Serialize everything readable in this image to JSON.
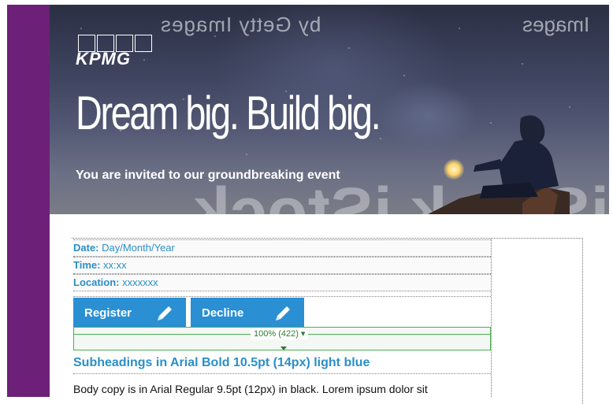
{
  "hero": {
    "watermark_top": "by Getty Images",
    "watermark_top_right": "Images",
    "watermark_bottom": "iStock  iStock",
    "logo": "KPMG",
    "headline": "Dream big. Build big.",
    "invitation": "You are invited to our groundbreaking event"
  },
  "details": {
    "date_label": "Date:",
    "date_value": " Day/Month/Year",
    "time_label": "Time:",
    "time_value": " xx:xx",
    "location_label": "Location:",
    "location_value": " xxxxxxx"
  },
  "buttons": {
    "register": "Register",
    "decline": "Decline"
  },
  "selection": {
    "badge": "100% (422) ▾"
  },
  "subheading": "Subheadings in Arial Bold 10.5pt (14px) light blue",
  "body_copy": "Body copy is in Arial Regular 9.5pt (12px) in black. Lorem ipsum dolor sit",
  "colors": {
    "brand_purple": "#6d2077",
    "link_blue": "#2a8fc8",
    "button_blue": "#2a8fd3",
    "selection_green": "#4caf50"
  }
}
